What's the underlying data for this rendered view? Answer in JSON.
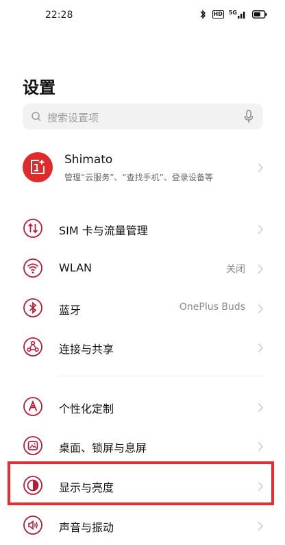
{
  "status_bar": {
    "time": "22:28",
    "hd_label": "HD",
    "network_label": "5G"
  },
  "page_title": "设置",
  "search": {
    "placeholder": "搜索设置项"
  },
  "account": {
    "name": "Shimato",
    "subtitle": "管理“云服务”、“查找手机”、登录设备等"
  },
  "settings_items": [
    {
      "label": "SIM 卡与流量管理",
      "value": "",
      "icon": "sim-data-icon"
    },
    {
      "label": "WLAN",
      "value": "关闭",
      "icon": "wifi-icon"
    },
    {
      "label": "蓝牙",
      "value": "OnePlus Buds",
      "icon": "bluetooth-icon"
    },
    {
      "label": "连接与共享",
      "value": "",
      "icon": "connection-share-icon"
    },
    {
      "label": "个性化定制",
      "value": "",
      "icon": "personalization-icon"
    },
    {
      "label": "桌面、锁屏与息屏",
      "value": "",
      "icon": "wallpaper-icon"
    },
    {
      "label": "显示与亮度",
      "value": "",
      "icon": "display-brightness-icon"
    },
    {
      "label": "声音与振动",
      "value": "",
      "icon": "sound-vibration-icon"
    }
  ],
  "colors": {
    "accent": "#b21e3a",
    "brand_red": "#e12b2b",
    "highlight_border": "#ee2a2a"
  }
}
